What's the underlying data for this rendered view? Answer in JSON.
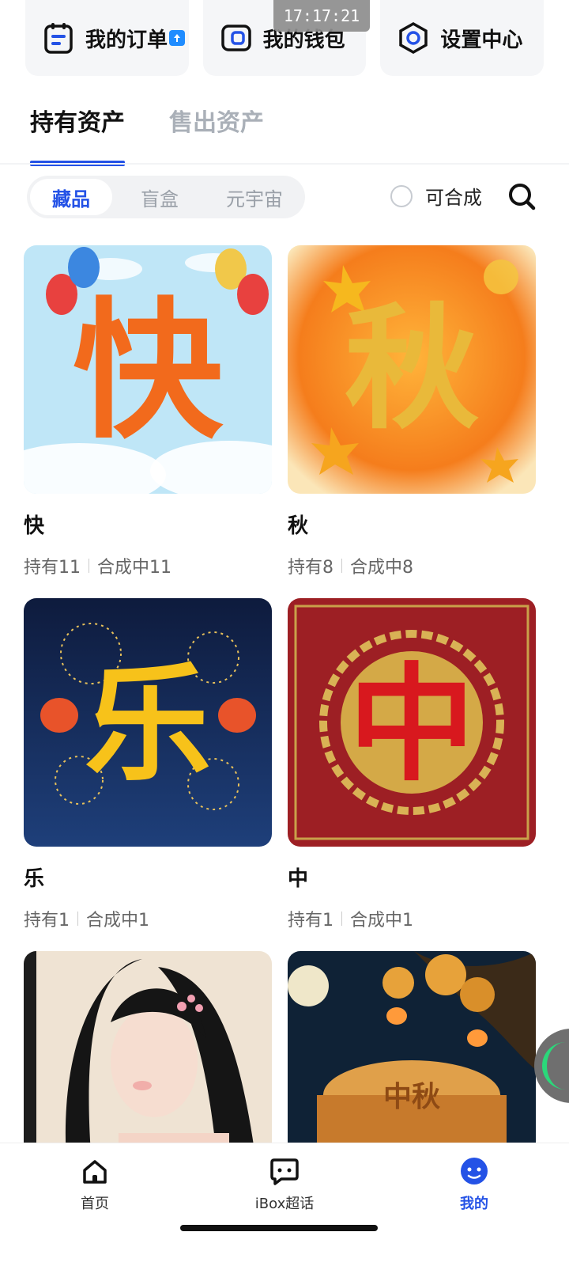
{
  "status": {
    "time": "17:17:21"
  },
  "quick_cards": [
    {
      "label": "我的订单",
      "icon": "order-icon"
    },
    {
      "label": "我的钱包",
      "icon": "wallet-icon"
    },
    {
      "label": "设置中心",
      "icon": "settings-icon"
    }
  ],
  "main_tabs": [
    {
      "label": "持有资产",
      "active": true
    },
    {
      "label": "售出资产",
      "active": false
    }
  ],
  "filter": {
    "segments": [
      {
        "label": "藏品",
        "active": true
      },
      {
        "label": "盲盒",
        "active": false
      },
      {
        "label": "元宇宙",
        "active": false
      }
    ],
    "combine_label": "可合成",
    "search_icon": "search-icon"
  },
  "items": [
    {
      "name": "快",
      "held": "持有11",
      "combining": "合成中11",
      "glyph": "快"
    },
    {
      "name": "秋",
      "held": "持有8",
      "combining": "合成中8",
      "glyph": "秋"
    },
    {
      "name": "乐",
      "held": "持有1",
      "combining": "合成中1",
      "glyph": "乐"
    },
    {
      "name": "中",
      "held": "持有1",
      "combining": "合成中1",
      "glyph": "中"
    },
    {
      "name": "",
      "held": "",
      "combining": "",
      "glyph": ""
    },
    {
      "name": "",
      "held": "",
      "combining": "",
      "glyph": "中秋"
    }
  ],
  "bottom_nav": [
    {
      "label": "首页",
      "icon": "home-icon",
      "active": false
    },
    {
      "label": "iBox超话",
      "icon": "chat-icon",
      "active": false
    },
    {
      "label": "我的",
      "icon": "profile-icon",
      "active": true
    }
  ],
  "colors": {
    "accent": "#2452e6",
    "muted": "#aab0b8"
  }
}
